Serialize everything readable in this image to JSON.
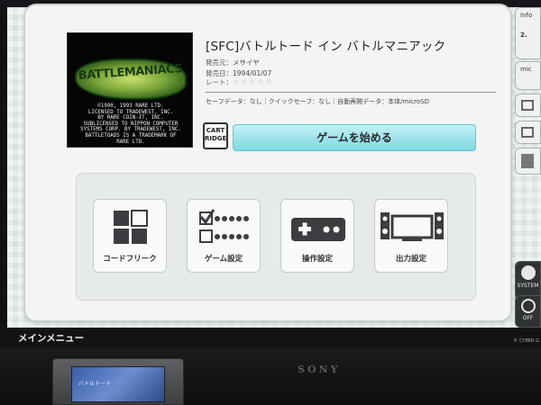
{
  "game": {
    "title": "[SFC]バトルトード イン バトルマニアック",
    "publisher_label": "発売元：",
    "publisher": "メサイヤ",
    "release_label": "発売日：",
    "release_date": "1994/01/07",
    "rating_label": "レート：",
    "rating_stars": "☆☆☆☆☆",
    "rating_value": 0,
    "save_info": "セーフデータ：なし｜クイックセーフ：なし｜自動再開データ：本体/microSD"
  },
  "boxart": {
    "logo": "BATTLEMANIACS",
    "credits": "©1990, 1993 RARE LTD.\nLICENSED TO TRADEWEST, INC.\nBY RARE COIN-IT, INC.\nSUBLICENSED TO NIPPON COMPUTER\nSYSTEMS CORP. BY TRADEWEST, INC.\nBATTLETOADS IS A TRADEMARK OF\nRARE LTD."
  },
  "cartridge_badge": "CART\nRIDGE",
  "start_button": "ゲームを始める",
  "tiles": [
    {
      "label": "コードフリーク",
      "icon": "grid-icon"
    },
    {
      "label": "ゲーム設定",
      "icon": "checklist-icon"
    },
    {
      "label": "操作設定",
      "icon": "controller-icon"
    },
    {
      "label": "出力設定",
      "icon": "tv-speakers-icon"
    }
  ],
  "side": {
    "info": "Info",
    "info_sub": "2.",
    "mic": "mic",
    "system": "SYSTEM",
    "power": "OFF"
  },
  "footer": {
    "title": "メインメニュー",
    "copyright": "© CYBER G"
  },
  "tv": {
    "brand": "SONY"
  },
  "physical_cart": {
    "label": "バトルトード"
  },
  "colors": {
    "accent": "#7ed8e2",
    "panel": "#f3f5f4",
    "icon": "#3b3d40"
  }
}
